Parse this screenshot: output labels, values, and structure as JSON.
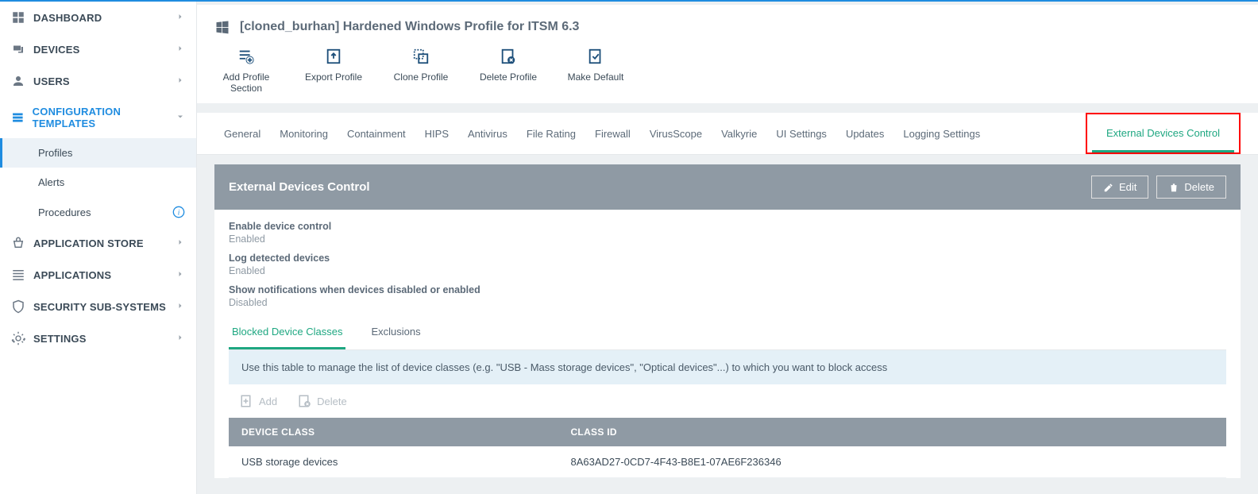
{
  "sidebar": {
    "items": [
      {
        "label": "DASHBOARD"
      },
      {
        "label": "DEVICES"
      },
      {
        "label": "USERS"
      },
      {
        "label": "CONFIGURATION TEMPLATES"
      },
      {
        "label": "APPLICATION STORE"
      },
      {
        "label": "APPLICATIONS"
      },
      {
        "label": "SECURITY SUB-SYSTEMS"
      },
      {
        "label": "SETTINGS"
      }
    ],
    "subs": {
      "profiles": "Profiles",
      "alerts": "Alerts",
      "procedures": "Procedures"
    }
  },
  "profile": {
    "title": "[cloned_burhan] Hardened Windows Profile for ITSM 6.3"
  },
  "toolbar": {
    "add": "Add Profile Section",
    "export": "Export Profile",
    "clone": "Clone Profile",
    "delete": "Delete Profile",
    "default": "Make Default"
  },
  "tabs": {
    "general": "General",
    "monitoring": "Monitoring",
    "containment": "Containment",
    "hips": "HIPS",
    "antivirus": "Antivirus",
    "filerating": "File Rating",
    "firewall": "Firewall",
    "virusscope": "VirusScope",
    "valkyrie": "Valkyrie",
    "uisettings": "UI Settings",
    "updates": "Updates",
    "logging": "Logging Settings",
    "external": "External Devices Control"
  },
  "panel": {
    "title": "External Devices Control",
    "edit": "Edit",
    "delete": "Delete",
    "settings": [
      {
        "label": "Enable device control",
        "value": "Enabled"
      },
      {
        "label": "Log detected devices",
        "value": "Enabled"
      },
      {
        "label": "Show notifications when devices disabled or enabled",
        "value": "Disabled"
      }
    ],
    "subtabs": {
      "blocked": "Blocked Device Classes",
      "exclusions": "Exclusions"
    },
    "infobar": "Use this table to manage the list of device classes (e.g. \"USB - Mass storage devices\", \"Optical devices\"...) to which you want to block access",
    "rowbtns": {
      "add": "Add",
      "delete": "Delete"
    },
    "table": {
      "headers": {
        "class": "DEVICE CLASS",
        "id": "CLASS ID"
      },
      "rows": [
        {
          "class": "USB storage devices",
          "id": "8A63AD27-0CD7-4F43-B8E1-07AE6F236346"
        }
      ]
    }
  }
}
